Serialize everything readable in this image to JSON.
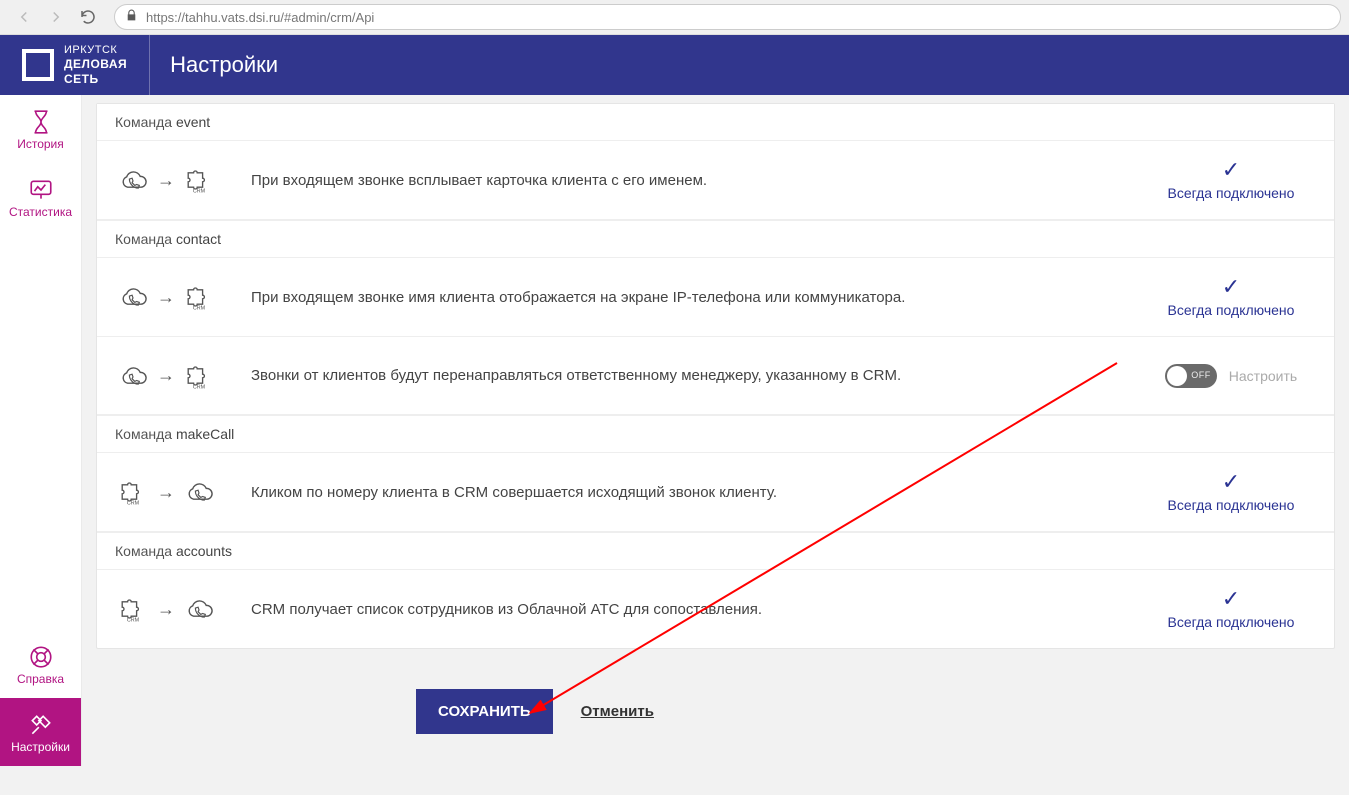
{
  "browser": {
    "url": "https://tahhu.vats.dsi.ru/#admin/crm/Api"
  },
  "header": {
    "brand_line1": "ИРКУТСК",
    "brand_line2": "ДЕЛОВАЯ",
    "brand_line3": "СЕТЬ",
    "title": "Настройки"
  },
  "sidebar": {
    "items": [
      {
        "key": "history",
        "label": "История"
      },
      {
        "key": "stats",
        "label": "Статистика"
      },
      {
        "key": "help",
        "label": "Справка"
      },
      {
        "key": "settings",
        "label": "Настройки"
      }
    ]
  },
  "sections": [
    {
      "head_label": "Команда",
      "head_name": "event",
      "rows": [
        {
          "direction": "cloud-to-crm",
          "desc": "При входящем звонке всплывает карточка клиента с его именем.",
          "status": "always",
          "status_label": "Всегда подключено"
        }
      ]
    },
    {
      "head_label": "Команда",
      "head_name": "contact",
      "rows": [
        {
          "direction": "cloud-to-crm",
          "desc": "При входящем звонке имя клиента отображается на экране IP-телефона или коммуникатора.",
          "status": "always",
          "status_label": "Всегда подключено"
        },
        {
          "direction": "cloud-to-crm",
          "desc": "Звонки от клиентов будут перенаправляться ответственному менеджеру, указанному в CRM.",
          "status": "toggle-off",
          "toggle_off_label": "OFF",
          "configure_label": "Настроить"
        }
      ]
    },
    {
      "head_label": "Команда",
      "head_name": "makeCall",
      "rows": [
        {
          "direction": "crm-to-cloud",
          "desc": "Кликом по номеру клиента в CRM совершается исходящий звонок клиенту.",
          "status": "always",
          "status_label": "Всегда подключено"
        }
      ]
    },
    {
      "head_label": "Команда",
      "head_name": "accounts",
      "rows": [
        {
          "direction": "crm-to-cloud",
          "desc": "CRM получает список сотрудников из Облачной АТС для сопоставления.",
          "status": "always",
          "status_label": "Всегда подключено"
        }
      ]
    }
  ],
  "footer": {
    "save": "СОХРАНИТЬ",
    "cancel": "Отменить"
  }
}
